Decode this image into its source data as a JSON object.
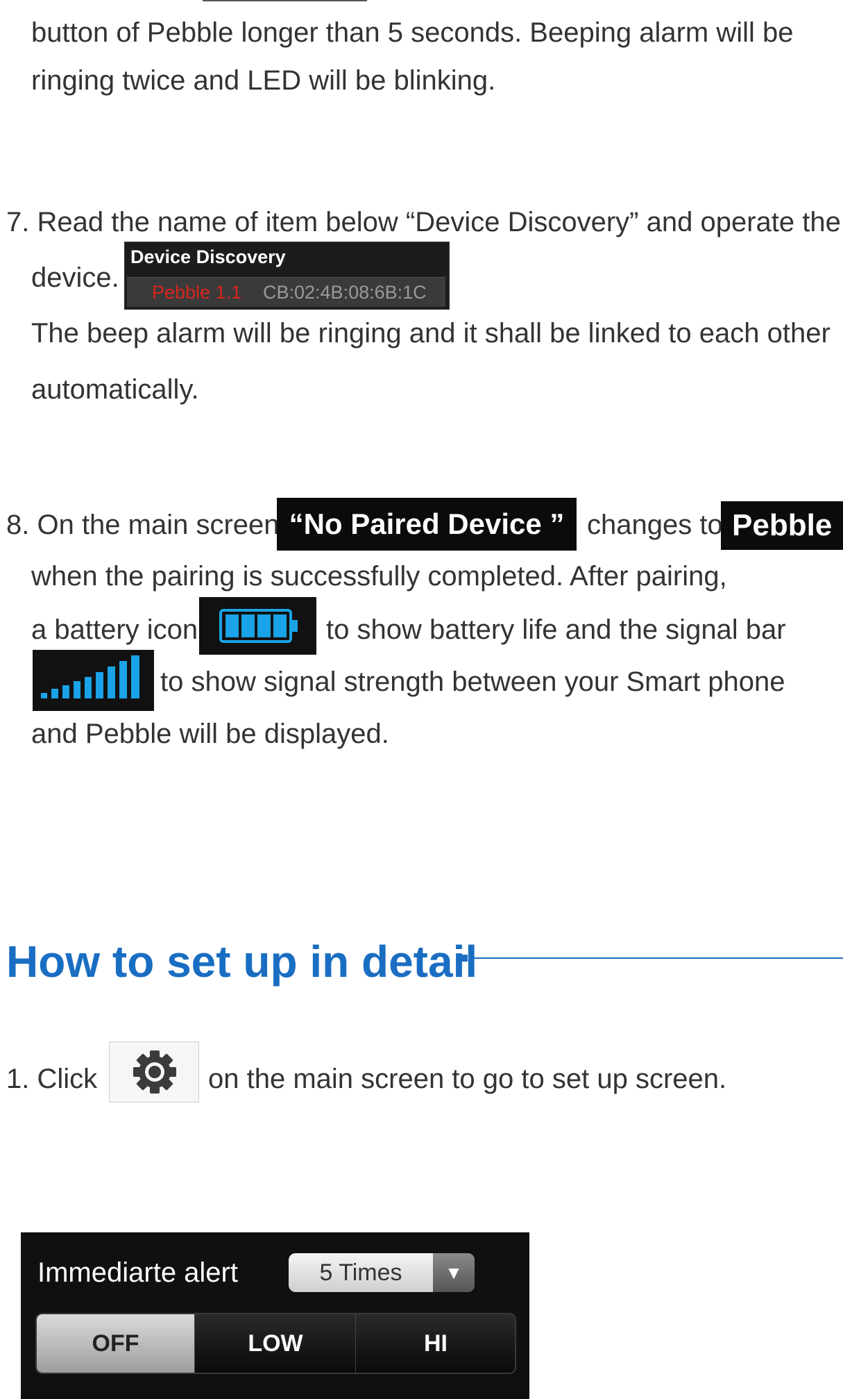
{
  "intro": {
    "line1": "button of Pebble longer than 5 seconds. Beeping alarm will be",
    "line2": "ringing twice and LED will be blinking."
  },
  "step7": {
    "line1": "7. Read the name of item below “Device Discovery” and operate the",
    "device_word": "device.",
    "line3": "The beep alarm will be ringing and it shall be linked to each other",
    "line4": "automatically.",
    "discovery": {
      "title": "Device Discovery",
      "device_name": "Pebble 1.1",
      "mac": "CB:02:4B:08:6B:1C"
    }
  },
  "step8": {
    "prefix": "8. On the main screen,",
    "no_paired_label": "“No Paired  Device ”",
    "changes_to": "changes to",
    "pebble_label": "Pebble",
    "line2": "when the pairing is successfully completed. After pairing,",
    "battery_prefix": "a battery icon",
    "battery_suffix": "to show battery life and the signal bar",
    "signal_suffix": "to show signal strength between your Smart phone",
    "line5": "and Pebble will be displayed."
  },
  "section": {
    "heading": "How to set up in detail",
    "accent_color": "#1a6ec2"
  },
  "setup_step1": {
    "click": "1. Click",
    "rest": "on the main screen to go to set up screen."
  },
  "alert_panel": {
    "label": "Immediarte alert",
    "select_value": "5 Times",
    "select_arrow": "▼",
    "options": [
      "OFF",
      "LOW",
      "HI"
    ],
    "selected_option": "OFF"
  },
  "icons": {
    "battery": "battery-icon",
    "signal": "signal-bar-icon",
    "settings": "gear-icon"
  },
  "colors": {
    "body_text": "#333333",
    "device_name": "#d8261c",
    "battery_cyan": "#1aa3e8"
  }
}
